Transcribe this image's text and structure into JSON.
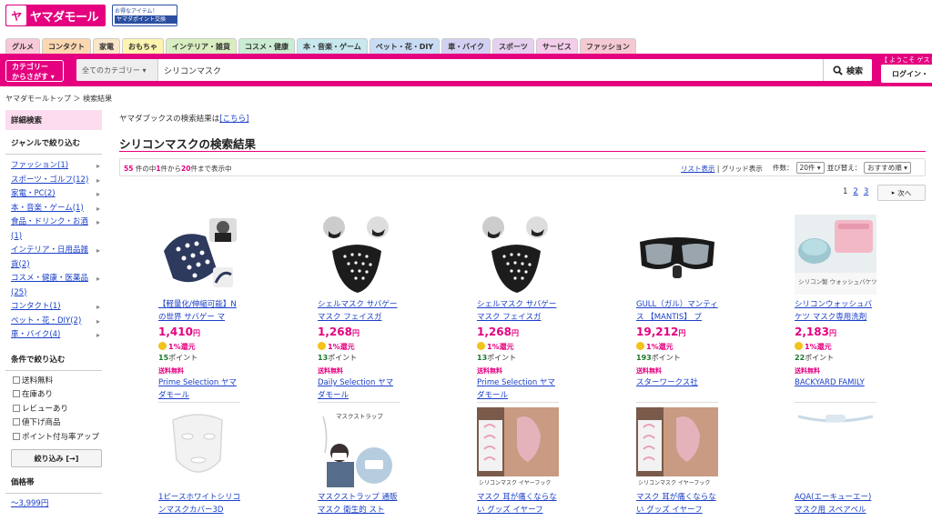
{
  "header": {
    "logo_mark": "ヤ",
    "logo_text": "ヤマダモール",
    "promo_line1": "お得なアイテム！",
    "promo_line2": "ヤマダポイント交換",
    "category_tabs": [
      {
        "label": "グルメ",
        "color": "#f8c9d8"
      },
      {
        "label": "コンタクト",
        "color": "#fbd8b0"
      },
      {
        "label": "家電",
        "color": "#fbe5c8"
      },
      {
        "label": "おもちゃ",
        "color": "#fdf4b0"
      },
      {
        "label": "インテリア・雑貨",
        "color": "#d9eec0"
      },
      {
        "label": "コスメ・健康",
        "color": "#c9ecd2"
      },
      {
        "label": "本・音楽・ゲーム",
        "color": "#c6e8ee"
      },
      {
        "label": "ペット・花・DIY",
        "color": "#c9dcf5"
      },
      {
        "label": "車・バイク",
        "color": "#d2d0f2"
      },
      {
        "label": "スポーツ",
        "color": "#e6d0f0"
      },
      {
        "label": "サービス",
        "color": "#f4cdea"
      },
      {
        "label": "ファッション",
        "color": "#f6c9d2"
      }
    ],
    "category_button": "カテゴリー\nからさがす ▾",
    "category_select": "全てのカテゴリー ▾",
    "search_value": "シリコンマスク",
    "search_button": "検索",
    "welcome": "【 ようこそ ゲスト様",
    "login": "ログイン・"
  },
  "breadcrumb": "ヤマダモールトップ ＞ 検索結果",
  "sidebar": {
    "detail_heading": "詳細検索",
    "genre_heading": "ジャンルで絞り込む",
    "genres": [
      "ファッション(1)",
      "スポーツ・ゴルフ(12)",
      "家電・PC(2)",
      "本・音楽・ゲーム(1)",
      "食品・ドリンク・お酒(1)",
      "インテリア・日用品雑貨(2)",
      "コスメ・健康・医薬品(25)",
      "コンタクト(1)",
      "ペット・花・DIY(2)",
      "車・バイク(4)"
    ],
    "condition_heading": "条件で絞り込む",
    "conditions": [
      "送料無料",
      "在庫あり",
      "レビューあり",
      "値下げ商品",
      "ポイント付与率アップ"
    ],
    "narrow_button": "絞り込み [→]",
    "price_heading": "価格帯",
    "price_first": "～3,999円"
  },
  "main": {
    "books_prefix": "ヤマダブックスの検索結果は",
    "books_link": "[こちら]",
    "title": "シリコンマスクの検索結果",
    "total": "55",
    "result_mid1": "件の中",
    "from": "1",
    "result_mid2": "件から",
    "to": "20",
    "result_tail": "件まで表示中",
    "list_view": "リスト表示",
    "view_sep": "|",
    "grid_view": "グリッド表示",
    "count_label": "件数：",
    "count_value": "20件 ▾",
    "sort_label": "並び替え：",
    "sort_value": "おすすめ順 ▾",
    "pages": [
      "1",
      "2",
      "3"
    ],
    "next": "次へ",
    "products": [
      {
        "name": "【軽量化/伸縮可能】Nの世界 サバゲー マ",
        "price": "1,410",
        "yen": "円",
        "rate": "1%還元",
        "points": "15",
        "pt_label": "ポイント",
        "shipping": "送料無料",
        "shop": "Prime Selection ヤマダモール"
      },
      {
        "name": "シェルマスク サバゲーマスク フェイスガ",
        "price": "1,268",
        "yen": "円",
        "rate": "1%還元",
        "points": "13",
        "pt_label": "ポイント",
        "shipping": "送料無料",
        "shop": "Daily Selection ヤマダモール"
      },
      {
        "name": "シェルマスク サバゲーマスク フェイスガ",
        "price": "1,268",
        "yen": "円",
        "rate": "1%還元",
        "points": "13",
        "pt_label": "ポイント",
        "shipping": "送料無料",
        "shop": "Prime Selection ヤマダモール"
      },
      {
        "name": "GULL（ガル）マンティス 【MANTIS】 ブ",
        "price": "19,212",
        "yen": "円",
        "rate": "1%還元",
        "points": "193",
        "pt_label": "ポイント",
        "shipping": "送料無料",
        "shop": "スターワークス社"
      },
      {
        "name": "シリコンウォッシュバケツ マスク専用洗剤",
        "price": "2,183",
        "yen": "円",
        "rate": "1%還元",
        "points": "22",
        "pt_label": "ポイント",
        "shipping": "送料無料",
        "shop": "BACKYARD FAMILY"
      },
      {
        "name": "1ピースホワイトシリコンマスクカバー3D",
        "price": "",
        "yen": "",
        "rate": "",
        "points": "",
        "pt_label": "",
        "shipping": "",
        "shop": ""
      },
      {
        "name": "マスクストラップ 通販 マスク 衛生的 スト",
        "price": "",
        "yen": "",
        "rate": "",
        "points": "",
        "pt_label": "",
        "shipping": "",
        "shop": ""
      },
      {
        "name": "マスク 耳が痛くならない グッズ イヤーフ",
        "price": "",
        "yen": "",
        "rate": "",
        "points": "",
        "pt_label": "",
        "shipping": "",
        "shop": ""
      },
      {
        "name": "マスク 耳が痛くならない グッズ イヤーフ",
        "price": "",
        "yen": "",
        "rate": "",
        "points": "",
        "pt_label": "",
        "shipping": "",
        "shop": ""
      },
      {
        "name": "AQA(エーキューエー) マスク用 スペアベル",
        "price": "",
        "yen": "",
        "rate": "",
        "points": "",
        "pt_label": "",
        "shipping": "",
        "shop": ""
      }
    ],
    "image_labels": {
      "strap": "マスクストラップ",
      "ear": "シリコンマスク イヤーフック",
      "bucket": "シリコン製 ウォッシュバケツ"
    }
  }
}
